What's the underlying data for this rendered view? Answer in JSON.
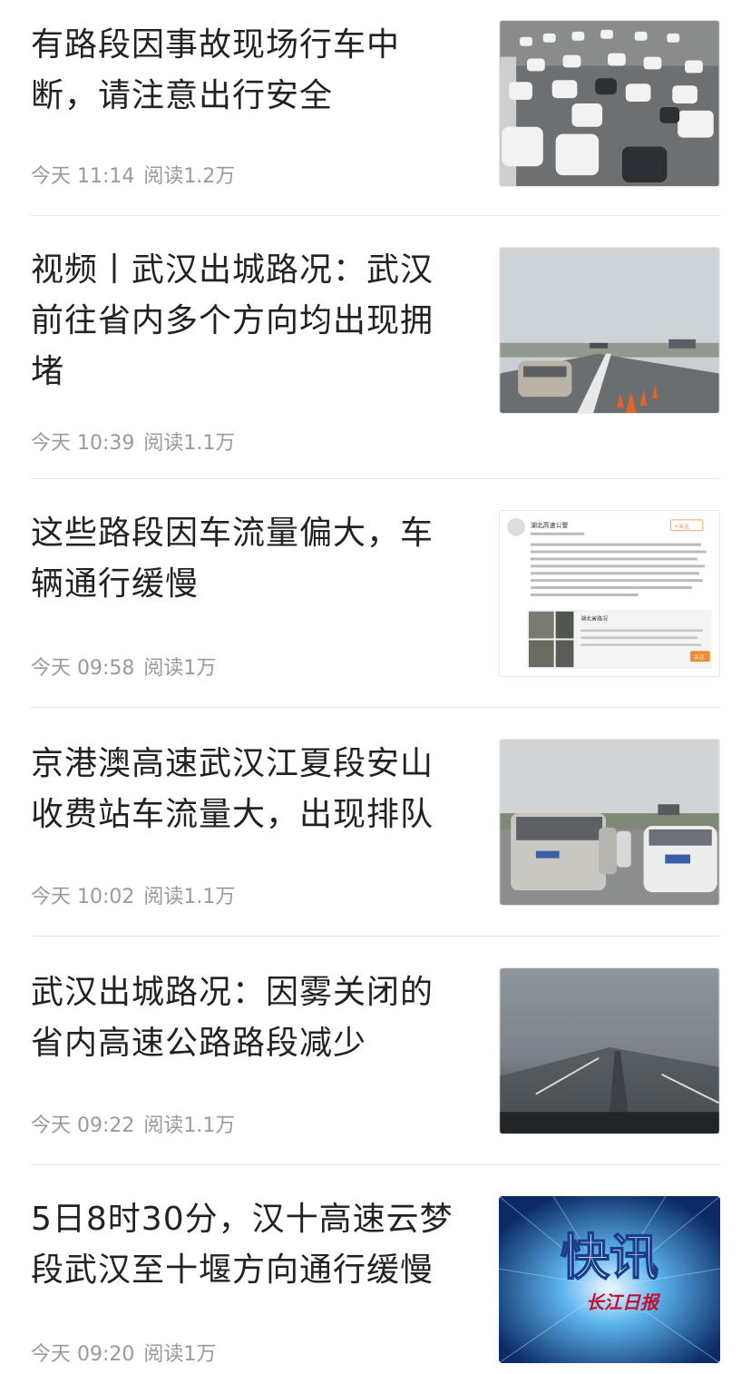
{
  "articles": [
    {
      "title": "有路段因事故现场行车中断，请注意出行安全",
      "time": "今天 11:14",
      "reads": "阅读1.2万",
      "image": "traffic-jam-cars"
    },
    {
      "title": "视频丨武汉出城路况：武汉前往省内多个方向均出现拥堵",
      "time": "今天 10:39",
      "reads": "阅读1.1万",
      "image": "highway-cones"
    },
    {
      "title": "这些路段因车流量偏大，车辆通行缓慢",
      "time": "今天 09:58",
      "reads": "阅读1万",
      "image": "weibo-post-screenshot"
    },
    {
      "title": "京港澳高速武汉江夏段安山收费站车流量大，出现排队",
      "time": "今天 10:02",
      "reads": "阅读1.1万",
      "image": "toll-station-queue"
    },
    {
      "title": "武汉出城路况：因雾关闭的省内高速公路路段减少",
      "time": "今天 09:22",
      "reads": "阅读1.1万",
      "image": "foggy-highway"
    },
    {
      "title": "5日8时30分，汉十高速云梦段武汉至十堰方向通行缓慢",
      "time": "今天 09:20",
      "reads": "阅读1万",
      "image": "news-flash-banner",
      "banner": {
        "headline": "快讯",
        "brand": "长江日报"
      }
    }
  ],
  "weibo_card": {
    "account": "湖北高速公警",
    "follow": "+关注",
    "card_title": "湖北省路况",
    "button": "关注"
  }
}
